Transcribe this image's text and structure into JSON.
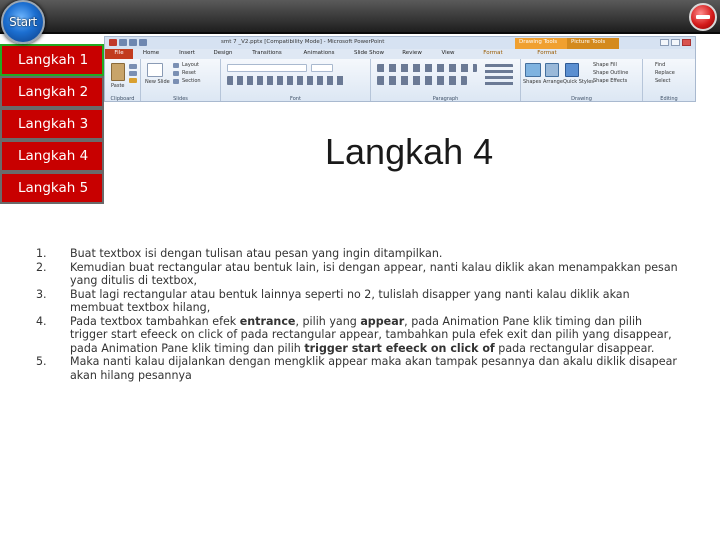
{
  "start": {
    "label": "Start"
  },
  "nav": {
    "items": [
      {
        "label": "Langkah 1"
      },
      {
        "label": "Langkah 2"
      },
      {
        "label": "Langkah 3"
      },
      {
        "label": "Langkah 4"
      },
      {
        "label": "Langkah 5"
      }
    ],
    "active_index": 0
  },
  "ribbon": {
    "window_title": "smt 7 _V2.pptx [Compatibility Mode] - Microsoft PowerPoint",
    "context_tabs": [
      "Drawing Tools",
      "Picture Tools"
    ],
    "tabs": [
      "File",
      "Home",
      "Insert",
      "Design",
      "Transitions",
      "Animations",
      "Slide Show",
      "Review",
      "View",
      "Format",
      "Format"
    ],
    "groups": [
      "Clipboard",
      "Slides",
      "Font",
      "Paragraph",
      "Drawing",
      "Editing"
    ],
    "buttons": {
      "paste": "Paste",
      "new_slide": "New Slide",
      "layout": "Layout",
      "reset": "Reset",
      "section": "Section",
      "shapes": "Shapes",
      "arrange": "Arrange",
      "quick_styles": "Quick Styles",
      "shape_fill": "Shape Fill",
      "shape_outline": "Shape Outline",
      "shape_effects": "Shape Effects",
      "find": "Find",
      "replace": "Replace",
      "select": "Select"
    }
  },
  "slide": {
    "title": "Langkah 4",
    "steps": [
      {
        "num": "1.",
        "parts": [
          {
            "text": "Buat textbox isi dengan tulisan atau pesan yang ingin ditampilkan.",
            "bold": false
          }
        ]
      },
      {
        "num": "2.",
        "parts": [
          {
            "text": "Kemudian buat rectangular atau bentuk lain, isi dengan appear, nanti kalau diklik akan menampakkan pesan yang ditulis di textbox,",
            "bold": false
          }
        ]
      },
      {
        "num": "3.",
        "parts": [
          {
            "text": "Buat lagi rectangular atau bentuk lainnya seperti no 2, tulislah disapper yang nanti kalau diklik akan membuat textbox hilang,",
            "bold": false
          }
        ]
      },
      {
        "num": "4.",
        "parts": [
          {
            "text": "Pada textbox tambahkan efek ",
            "bold": false
          },
          {
            "text": "entrance",
            "bold": true
          },
          {
            "text": ", pilih yang ",
            "bold": false
          },
          {
            "text": "appear",
            "bold": true
          },
          {
            "text": ", pada Animation Pane klik timing dan pilih trigger start efeeck on click of pada rectangular appear, tambahkan pula efek exit dan pilih yang disappear, pada Animation Pane  klik timing dan pilih ",
            "bold": false
          },
          {
            "text": "trigger start efeeck on click of",
            "bold": true
          },
          {
            "text": " pada rectangular disappear.",
            "bold": false
          }
        ]
      },
      {
        "num": "5.",
        "parts": [
          {
            "text": "Maka nanti kalau dijalankan dengan mengklik appear maka akan tampak pesannya dan akalu diklik disapear akan hilang pesannya",
            "bold": false
          }
        ]
      }
    ]
  },
  "colors": {
    "nav_bg": "#c80000",
    "nav_active_border": "#22aa22",
    "topbar": "#2a2a2a",
    "file_tab": "#c23b1e"
  },
  "icons": [
    "start-orb-icon",
    "exit-icon"
  ]
}
